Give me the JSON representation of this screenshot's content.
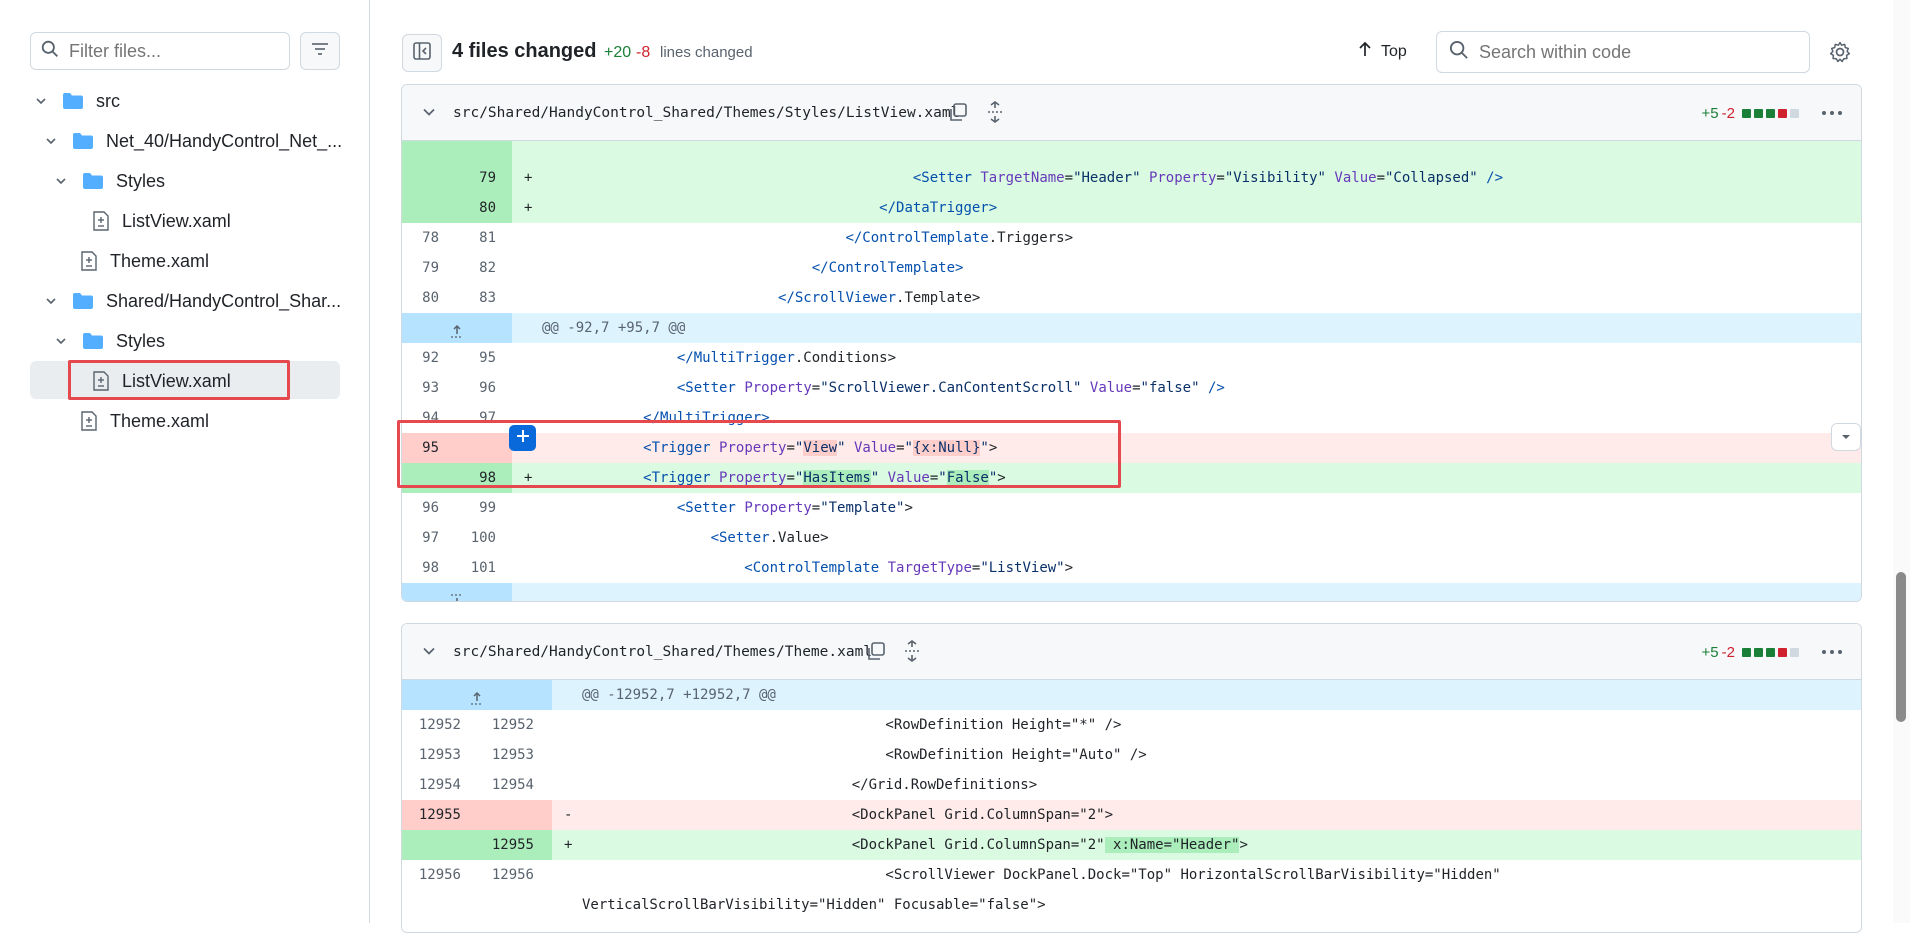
{
  "sidebar": {
    "filter_placeholder": "Filter files...",
    "tree": [
      {
        "label": "src",
        "type": "folder"
      },
      {
        "label": "Net_40/HandyControl_Net_...",
        "type": "folder"
      },
      {
        "label": "Styles",
        "type": "folder"
      },
      {
        "label": "ListView.xaml",
        "type": "file"
      },
      {
        "label": "Theme.xaml",
        "type": "file"
      },
      {
        "label": "Shared/HandyControl_Shar...",
        "type": "folder"
      },
      {
        "label": "Styles",
        "type": "folder"
      },
      {
        "label": "ListView.xaml",
        "type": "file",
        "selected": true
      },
      {
        "label": "Theme.xaml",
        "type": "file"
      }
    ]
  },
  "toolbar": {
    "files_changed": "4 files changed",
    "additions": "+20",
    "deletions": "-8",
    "lines_changed": "lines changed",
    "top_label": "Top",
    "search_placeholder": "Search within code"
  },
  "file1": {
    "path": "src/Shared/HandyControl_Shared/Themes/Styles/ListView.xaml",
    "adds": "+5",
    "dels": "-2",
    "rows": [
      {
        "t": "add",
        "n1": "",
        "n2": "79",
        "m": "+",
        "html": "                                            <span class=\"t\">&lt;Setter</span> <span class=\"a\">TargetName</span>=<span class=\"v\">\"Header\"</span> <span class=\"a\">Property</span>=<span class=\"v\">\"Visibility\"</span> <span class=\"a\">Value</span>=<span class=\"v\">\"Collapsed\"</span> <span class=\"t\">/&gt;</span>"
      },
      {
        "t": "add",
        "n1": "",
        "n2": "80",
        "m": "+",
        "html": "                                        <span class=\"t\">&lt;/DataTrigger&gt;</span>"
      },
      {
        "t": "ctx",
        "n1": "78",
        "n2": "81",
        "m": "",
        "html": "                                    <span class=\"t\">&lt;/ControlTemplate</span>.Triggers&gt;"
      },
      {
        "t": "ctx",
        "n1": "79",
        "n2": "82",
        "m": "",
        "html": "                                <span class=\"t\">&lt;/ControlTemplate&gt;</span>"
      },
      {
        "t": "ctx",
        "n1": "80",
        "n2": "83",
        "m": "",
        "html": "                            <span class=\"t\">&lt;/ScrollViewer</span>.Template&gt;"
      },
      {
        "t": "hunk",
        "n1": "",
        "n2": "",
        "m": "",
        "html": "@@ -92,7 +95,7 @@"
      },
      {
        "t": "ctx",
        "n1": "92",
        "n2": "95",
        "m": "",
        "html": "                <span class=\"t\">&lt;/MultiTrigger</span>.Conditions&gt;"
      },
      {
        "t": "ctx",
        "n1": "93",
        "n2": "96",
        "m": "",
        "html": "                <span class=\"t\">&lt;Setter</span> <span class=\"a\">Property</span>=<span class=\"v\">\"ScrollViewer.CanContentScroll\"</span> <span class=\"a\">Value</span>=<span class=\"v\">\"false\"</span> <span class=\"t\">/&gt;</span>"
      },
      {
        "t": "ctx",
        "n1": "94",
        "n2": "97",
        "m": "",
        "html": "            <span class=\"t\">&lt;/MultiTrigger&gt;</span>"
      },
      {
        "t": "del",
        "n1": "95",
        "n2": "",
        "m": "",
        "html": "            <span class=\"t\">&lt;Trigger</span> <span class=\"a\">Property</span>=<span class=\"v\">\"<span class=\"hl-del\">View</span>\"</span> <span class=\"a\">Value</span>=<span class=\"v\">\"<span class=\"hl-del\">{x:Null}</span>\"</span>&gt;"
      },
      {
        "t": "add",
        "n1": "",
        "n2": "98",
        "m": "+",
        "html": "            <span class=\"t\">&lt;Trigger</span> <span class=\"a\">Property</span>=<span class=\"v\">\"<span class=\"hl-add\">HasItems</span>\"</span> <span class=\"a\">Value</span>=<span class=\"v\">\"<span class=\"hl-add\">False</span>\"</span>&gt;"
      },
      {
        "t": "ctx",
        "n1": "96",
        "n2": "99",
        "m": "",
        "html": "                <span class=\"t\">&lt;Setter</span> <span class=\"a\">Property</span>=<span class=\"v\">\"Template\"</span>&gt;"
      },
      {
        "t": "ctx",
        "n1": "97",
        "n2": "100",
        "m": "",
        "html": "                    <span class=\"t\">&lt;Setter</span>.Value&gt;"
      },
      {
        "t": "ctx",
        "n1": "98",
        "n2": "101",
        "m": "",
        "html": "                        <span class=\"t\">&lt;ControlTemplate</span> <span class=\"a\">TargetType</span>=<span class=\"v\">\"ListView\"</span>&gt;"
      },
      {
        "t": "hunkend",
        "n1": "",
        "n2": "",
        "m": "",
        "html": ""
      }
    ]
  },
  "file2": {
    "path": "src/Shared/HandyControl_Shared/Themes/Theme.xaml",
    "adds": "+5",
    "dels": "-2",
    "rows": [
      {
        "t": "hunk",
        "n1": "",
        "n2": "",
        "m": "",
        "html": "@@ -12952,7 +12952,7 @@"
      },
      {
        "t": "ctx",
        "n1": "12952",
        "n2": "12952",
        "m": "",
        "html": "                                    &lt;RowDefinition Height=\"*\" /&gt;"
      },
      {
        "t": "ctx",
        "n1": "12953",
        "n2": "12953",
        "m": "",
        "html": "                                    &lt;RowDefinition Height=\"Auto\" /&gt;"
      },
      {
        "t": "ctx",
        "n1": "12954",
        "n2": "12954",
        "m": "",
        "html": "                                &lt;/Grid.RowDefinitions&gt;"
      },
      {
        "t": "del",
        "n1": "12955",
        "n2": "",
        "m": "-",
        "html": "                                &lt;DockPanel Grid.ColumnSpan=\"2\"&gt;"
      },
      {
        "t": "add",
        "n1": "",
        "n2": "12955",
        "m": "+",
        "html": "                                &lt;DockPanel Grid.ColumnSpan=\"2\"<span class=\"hl-add\"> x:Name=\"Header\"</span>&gt;"
      },
      {
        "t": "ctx",
        "n1": "12956",
        "n2": "12956",
        "m": "",
        "html": "                                    &lt;ScrollViewer DockPanel.Dock=\"Top\" HorizontalScrollBarVisibility=\"Hidden\""
      },
      {
        "t": "ctx",
        "n1": "",
        "n2": "",
        "m": "",
        "html": "VerticalScrollBarVisibility=\"Hidden\" Focusable=\"false\"&gt;"
      }
    ]
  }
}
